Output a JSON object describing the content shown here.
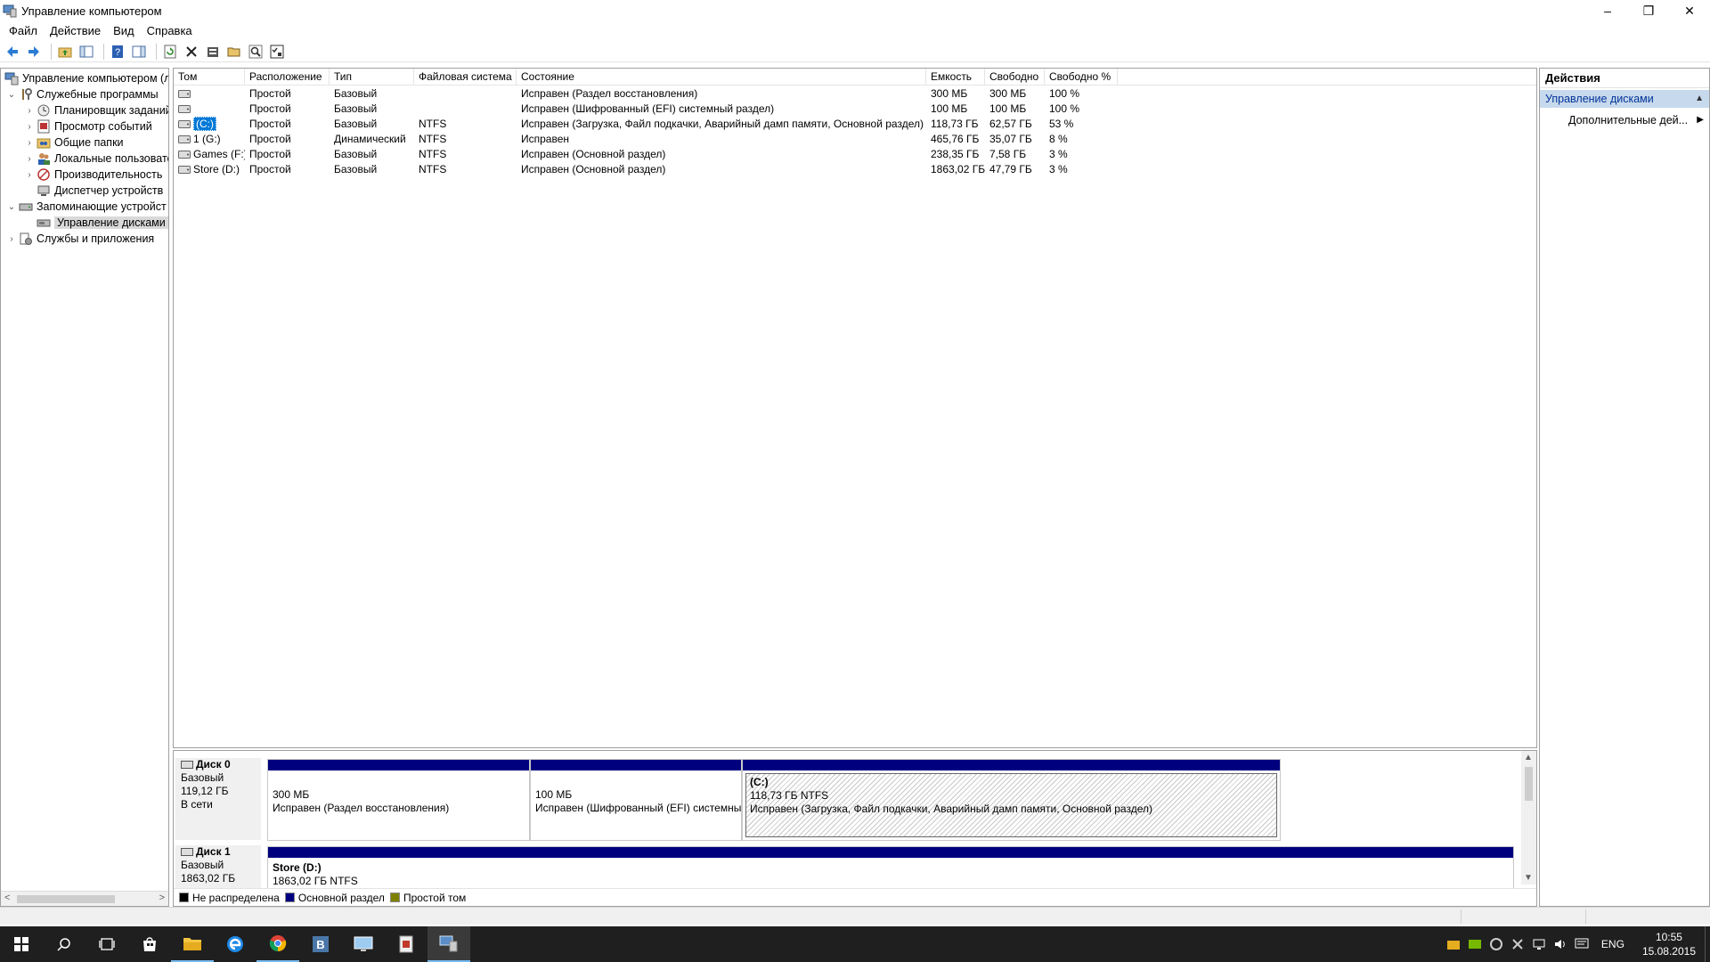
{
  "window": {
    "title": "Управление компьютером",
    "controls": {
      "minimize": "–",
      "restore": "❐",
      "close": "✕"
    }
  },
  "menu": [
    "Файл",
    "Действие",
    "Вид",
    "Справка"
  ],
  "tree": {
    "items": [
      {
        "label": "Управление компьютером (л",
        "arrow": "",
        "level": 0,
        "icon": "computer-management-icon"
      },
      {
        "label": "Служебные программы",
        "arrow": "⌄",
        "level": 1,
        "icon": "tools-icon"
      },
      {
        "label": "Планировщик заданий",
        "arrow": "›",
        "level": 2,
        "icon": "clock-icon"
      },
      {
        "label": "Просмотр событий",
        "arrow": "›",
        "level": 2,
        "icon": "event-viewer-icon"
      },
      {
        "label": "Общие папки",
        "arrow": "›",
        "level": 2,
        "icon": "shared-folder-icon"
      },
      {
        "label": "Локальные пользовате",
        "arrow": "›",
        "level": 2,
        "icon": "users-icon"
      },
      {
        "label": "Производительность",
        "arrow": "›",
        "level": 2,
        "icon": "performance-icon"
      },
      {
        "label": "Диспетчер устройств",
        "arrow": "",
        "level": 2,
        "icon": "device-manager-icon"
      },
      {
        "label": "Запоминающие устройст",
        "arrow": "⌄",
        "level": 1,
        "icon": "storage-icon"
      },
      {
        "label": "Управление дисками",
        "arrow": "",
        "level": 2,
        "icon": "disk-management-icon",
        "selected": true
      },
      {
        "label": "Службы и приложения",
        "arrow": "›",
        "level": 1,
        "icon": "services-icon"
      }
    ],
    "scroll_left": "<",
    "scroll_right": ">"
  },
  "volumes": {
    "columns": [
      "Том",
      "Расположение",
      "Тип",
      "Файловая система",
      "Состояние",
      "Емкость",
      "Свободно",
      "Свободно %"
    ],
    "rows": [
      [
        "",
        "Простой",
        "Базовый",
        "",
        "Исправен (Раздел восстановления)",
        "300 МБ",
        "300 МБ",
        "100 %"
      ],
      [
        "",
        "Простой",
        "Базовый",
        "",
        "Исправен (Шифрованный (EFI) системный раздел)",
        "100 МБ",
        "100 МБ",
        "100 %"
      ],
      [
        "(C:)",
        "Простой",
        "Базовый",
        "NTFS",
        "Исправен (Загрузка, Файл подкачки, Аварийный дамп памяти, Основной раздел)",
        "118,73 ГБ",
        "62,57 ГБ",
        "53 %"
      ],
      [
        "1 (G:)",
        "Простой",
        "Динамический",
        "NTFS",
        "Исправен",
        "465,76 ГБ",
        "35,07 ГБ",
        "8 %"
      ],
      [
        "Games (F:)",
        "Простой",
        "Базовый",
        "NTFS",
        "Исправен (Основной раздел)",
        "238,35 ГБ",
        "7,58 ГБ",
        "3 %"
      ],
      [
        "Store (D:)",
        "Простой",
        "Базовый",
        "NTFS",
        "Исправен (Основной раздел)",
        "1863,02 ГБ",
        "47,79 ГБ",
        "3 %"
      ]
    ],
    "selected_row": 2
  },
  "disks": [
    {
      "name": "Диск 0",
      "type": "Базовый",
      "size": "119,12 ГБ",
      "status": "В сети",
      "partitions": [
        {
          "title": "",
          "line1": "300 МБ",
          "line2": "Исправен (Раздел восстановления)"
        },
        {
          "title": "",
          "line1": "100 МБ",
          "line2": "Исправен (Шифрованный (EFI) системный раздел)"
        },
        {
          "title": "(C:)",
          "line1": "118,73 ГБ NTFS",
          "line2": "Исправен (Загрузка, Файл подкачки, Аварийный дамп памяти, Основной раздел)"
        }
      ]
    },
    {
      "name": "Диск 1",
      "type": "Базовый",
      "size": "1863,02 ГБ",
      "status": "",
      "partitions": [
        {
          "title": "Store  (D:)",
          "line1": "1863,02 ГБ NTFS",
          "line2": ""
        }
      ]
    }
  ],
  "legend": [
    {
      "label": "Не распределена",
      "color": "#000000"
    },
    {
      "label": "Основной раздел",
      "color": "#00007f"
    },
    {
      "label": "Простой том",
      "color": "#808000"
    }
  ],
  "actions": {
    "title": "Действия",
    "section": "Управление дисками",
    "section_caret": "▲",
    "item": "Дополнительные дей...",
    "item_caret": "▶"
  },
  "taskbar": {
    "lang": "ENG",
    "time": "10:55",
    "date": "15.08.2015"
  },
  "colors": {
    "primary_partition": "#00007f",
    "selection": "#0078d7",
    "actions_header": "#c7d9ec",
    "taskbar": "#1f1f1f"
  }
}
